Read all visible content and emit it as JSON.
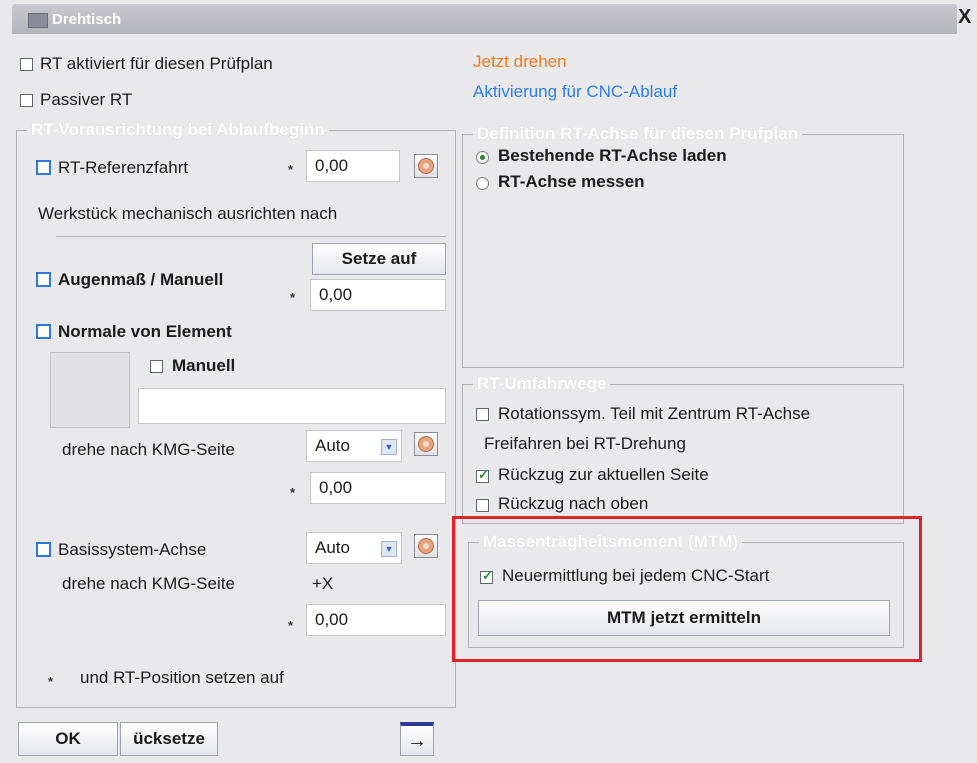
{
  "window": {
    "title": "Drehtisch",
    "close_symbol": "X"
  },
  "left": {
    "rt_activated": {
      "label": "RT aktiviert für diesen Prüfplan",
      "checked": false
    },
    "passive_rt": {
      "label": "Passiver RT",
      "checked": false
    },
    "group_title": "RT-Vorausrichtung bei Ablaufbeginn",
    "reference_run": {
      "label": "RT-Referenzfahrt",
      "value": "0,00"
    },
    "align_text": "Werkstück mechanisch ausrichten nach",
    "set_button": "Setze auf",
    "eye_manual": {
      "label": "Augenmaß / Manuell",
      "value": "0,00"
    },
    "element_normal": {
      "label": "Normale von Element"
    },
    "manual": {
      "label": "Manuell"
    },
    "element_field_value": "",
    "rotate_side_1": {
      "label": "drehe nach KMG-Seite",
      "select_value": "Auto",
      "value": "0,00"
    },
    "base_axis": {
      "label": "Basissystem-Achse",
      "select_value": "Auto"
    },
    "rotate_side_2": {
      "label": "drehe nach KMG-Seite",
      "axis": "+X",
      "value": "0,00"
    },
    "position_text": "und RT-Position setzen auf",
    "star_symbol": "*"
  },
  "right": {
    "rotate_now": "Jetzt drehen",
    "activation_cnc": "Aktivierung für CNC-Ablauf",
    "axis_group_title": "Definition RT-Achse für diesen Prüfplan",
    "load_axis": {
      "label": "Bestehende RT-Achse laden",
      "selected": true
    },
    "measure_axis": {
      "label": "RT-Achse messen",
      "selected": false
    },
    "paths_group_title": "RT-Umfahrwege",
    "rotation_sym": {
      "label": "Rotationssym. Teil mit Zentrum RT-Achse",
      "checked": false
    },
    "free_run_text": "Freifahren bei RT-Drehung",
    "retract_current": {
      "label": "Rückzug zur aktuellen Seite",
      "checked": true
    },
    "retract_top": {
      "label": "Rückzug nach oben",
      "checked": false
    },
    "mtm_group_title": "Massenträgheitsmoment (MTM)",
    "redetermine": {
      "label": "Neuermittlung bei jedem CNC-Start",
      "checked": true
    },
    "mtm_button": "MTM jetzt ermitteln"
  },
  "footer": {
    "ok": "OK",
    "reset": "ücksetze",
    "exit_symbol": "→"
  },
  "colors": {
    "highlight": "#e0222a",
    "link_orange": "#ee7a1e",
    "link_blue": "#2e7de0",
    "checkbox_blue": "#2f77d9",
    "check_green": "#2a8a2a"
  }
}
